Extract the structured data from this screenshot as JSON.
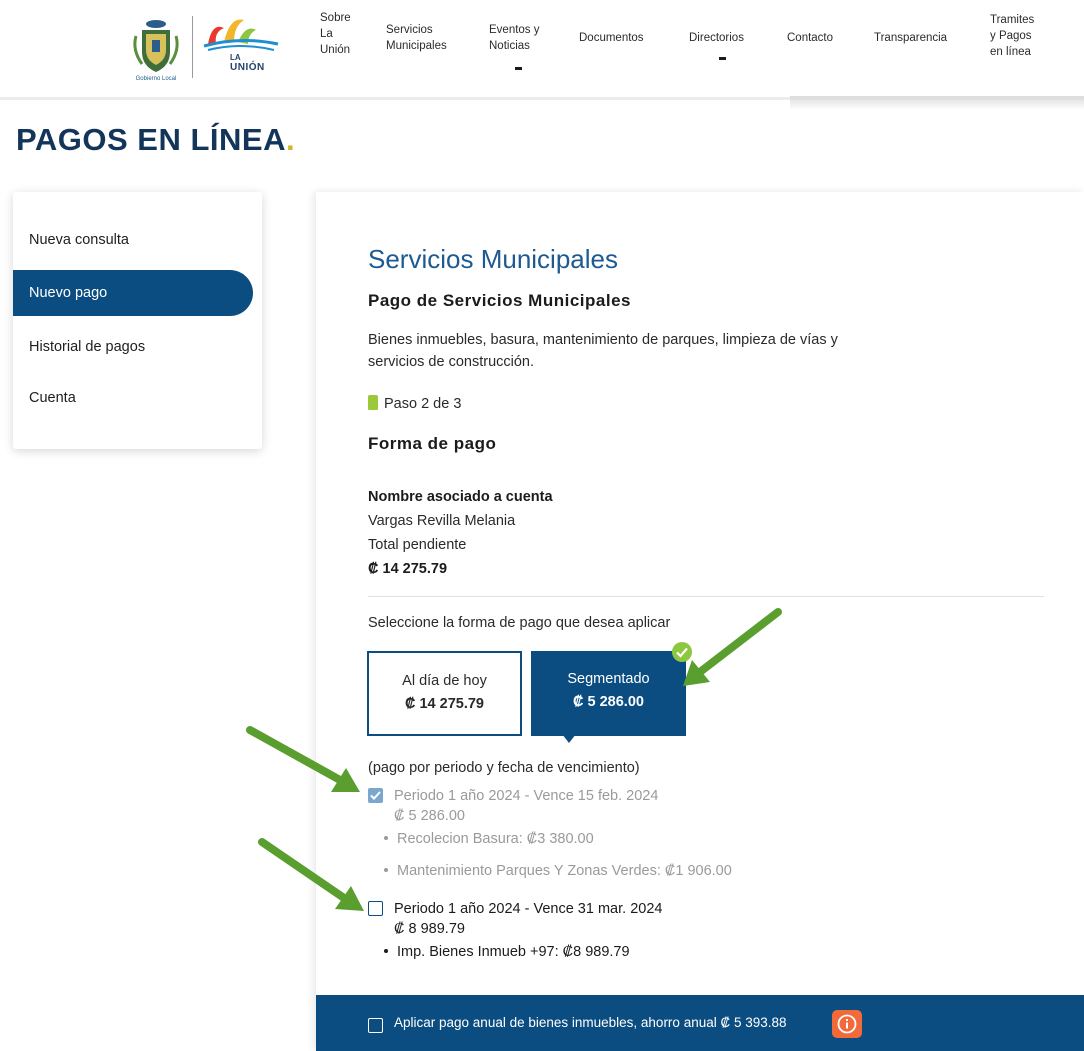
{
  "header": {
    "crest_caption": "Gobierno Local",
    "logo_la": "LA",
    "logo_name": "UNIÓN",
    "nav": [
      {
        "label": "Sobre\nLa\nUnión"
      },
      {
        "label": "Servicios\nMunicipales"
      },
      {
        "label": "Eventos y\nNoticias"
      },
      {
        "label": "Documentos"
      },
      {
        "label": "Directorios"
      },
      {
        "label": "Contacto"
      },
      {
        "label": "Transparencia"
      },
      {
        "label": "Tramites\ny Pagos\nen línea"
      }
    ]
  },
  "page": {
    "title": "PAGOS EN LÍNEA",
    "title_dot": "."
  },
  "side_menu": {
    "items": [
      {
        "label": "Nueva consulta"
      },
      {
        "label": "Nuevo pago"
      },
      {
        "label": "Historial de pagos"
      },
      {
        "label": "Cuenta"
      }
    ]
  },
  "main": {
    "heading": "Servicios Municipales",
    "subheading": "Pago de Servicios Municipales",
    "description": "Bienes inmuebles, basura, mantenimiento de parques, limpieza de vías y servicios de construcción.",
    "step": "Paso 2 de 3",
    "form_heading": "Forma de pago",
    "account_label": "Nombre asociado a cuenta",
    "account_name": "Vargas Revilla Melania",
    "total_label": "Total pendiente",
    "total_value": "₡ 14 275.79",
    "select_prompt": "Seleccione la forma de pago que desea aplicar",
    "options": [
      {
        "label": "Al día de hoy",
        "amount": "₡ 14 275.79"
      },
      {
        "label": "Segmentado",
        "amount": "₡ 5 286.00"
      }
    ],
    "payment_note": "(pago por periodo y fecha de vencimiento)",
    "periods": [
      {
        "title": "Periodo 1 año 2024 - Vence 15 feb. 2024",
        "amount": "₡ 5 286.00",
        "items": [
          "Recolecion Basura: ₡3 380.00",
          "Mantenimiento Parques Y Zonas Verdes: ₡1 906.00"
        ]
      },
      {
        "title": "Periodo 1 año 2024 - Vence 31 mar. 2024",
        "amount": "₡ 8 989.79",
        "items": [
          "Imp. Bienes Inmueb +97: ₡8 989.79"
        ]
      }
    ]
  },
  "bottom_bar": {
    "text": "Aplicar pago anual de bienes inmuebles, ahorro anual ₡ 5 393.88"
  },
  "colors": {
    "primary": "#0b4d80",
    "accent_green": "#8dc63f",
    "title_dot": "#d4b52b",
    "info_orange": "#f26a3a",
    "arrow_green": "#5a9e2f"
  }
}
